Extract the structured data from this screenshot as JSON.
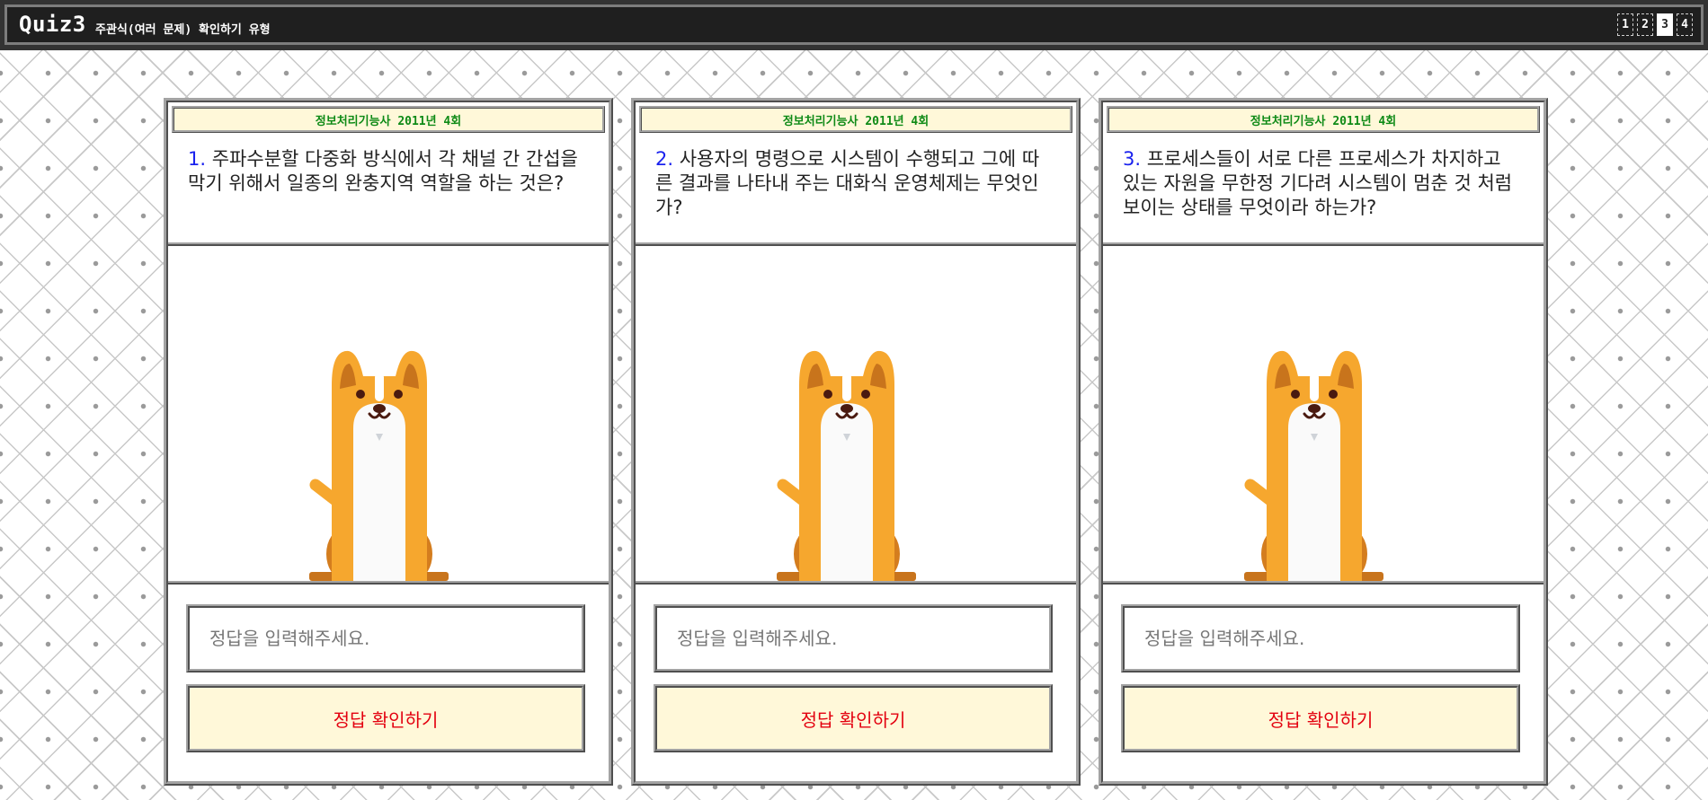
{
  "header": {
    "logo": "Quiz3",
    "subtitle": "주관식(여러 문제) 확인하기 유형",
    "pages": [
      "1",
      "2",
      "3",
      "4"
    ],
    "active_page": "3"
  },
  "cards": [
    {
      "exam_title": "정보처리기능사 2011년 4회",
      "number": "1.",
      "question": "주파수분할 다중화 방식에서 각 채널 간 간섭을 막기 위해서 일종의 완충지역 역할을 하는 것은?",
      "answer_placeholder": "정답을 입력해주세요.",
      "check_label": "정답 확인하기",
      "illustration_icon": "dog-icon"
    },
    {
      "exam_title": "정보처리기능사 2011년 4회",
      "number": "2.",
      "question": "사용자의 명령으로 시스템이 수행되고 그에 따른 결과를 나타내 주는 대화식 운영체제는 무엇인가?",
      "answer_placeholder": "정답을 입력해주세요.",
      "check_label": "정답 확인하기",
      "illustration_icon": "dog-icon"
    },
    {
      "exam_title": "정보처리기능사 2011년 4회",
      "number": "3.",
      "question": "프로세스들이 서로 다른 프로세스가 차지하고 있는 자원을 무한정 기다려 시스템이 멈춘 것 처럼 보이는 상태를 무엇이라 하는가?",
      "answer_placeholder": "정답을 입력해주세요.",
      "check_label": "정답 확인하기",
      "illustration_icon": "dog-icon"
    }
  ],
  "colors": {
    "header_bg": "#1f1f1f",
    "title_text": "#0e8a16",
    "question_number": "#1a22ee",
    "button_text": "#e3000f",
    "button_bg": "#fff8d9",
    "dog_orange": "#f6a72e"
  }
}
